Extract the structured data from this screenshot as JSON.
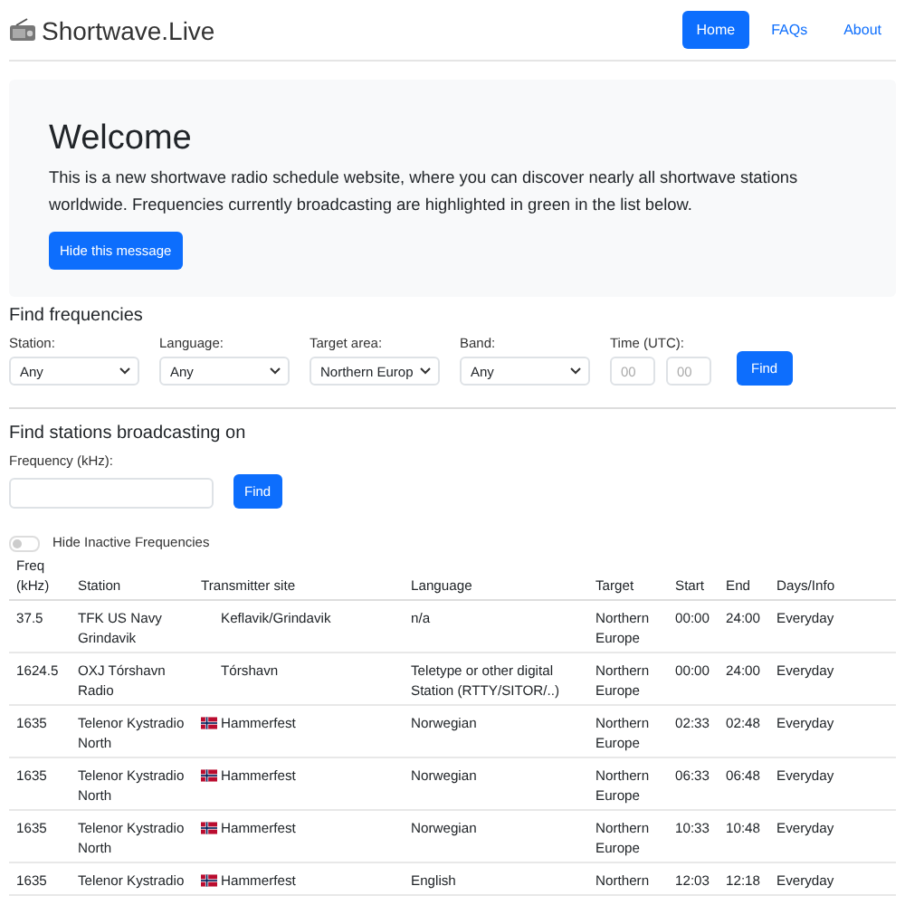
{
  "brand": "Shortwave.Live",
  "nav": [
    {
      "label": "Home",
      "selected": true
    },
    {
      "label": "FAQs",
      "selected": false
    },
    {
      "label": "About",
      "selected": false
    }
  ],
  "hero": {
    "title": "Welcome",
    "text": "This is a new shortwave radio schedule website, where you can discover nearly all shortwave stations worldwide. Frequencies currently broadcasting are highlighted in green in the list below.",
    "button": "Hide this message"
  },
  "find_frequencies": {
    "title": "Find frequencies",
    "fields": [
      {
        "kind": "select",
        "label": "Station:",
        "value": "Any"
      },
      {
        "kind": "select",
        "label": "Language:",
        "value": "Any"
      },
      {
        "kind": "select",
        "label": "Target area:",
        "value": "Northern Europ"
      },
      {
        "kind": "select",
        "label": "Band:",
        "value": "Any"
      },
      {
        "kind": "time",
        "label": "Time (UTC):",
        "placeholders": [
          "00",
          "00"
        ]
      }
    ],
    "button": "Find"
  },
  "find_stations": {
    "title": "Find stations broadcasting on",
    "label": "Frequency (kHz):",
    "button": "Find"
  },
  "hide_inactive": {
    "label": "Hide Inactive Frequencies",
    "on": false
  },
  "table": {
    "columns": [
      "Freq (kHz)",
      "Station",
      "Transmitter site",
      "Language",
      "Target",
      "Start",
      "End",
      "Days/Info"
    ],
    "rows": [
      {
        "freq": "37.5",
        "station": "TFK US Navy Grindavik",
        "flag": false,
        "site": "Keflavik/Grindavik",
        "language": "n/a",
        "target": "Northern Europe",
        "start": "00:00",
        "end": "24:00",
        "days": "Everyday"
      },
      {
        "freq": "1624.5",
        "station": "OXJ Tórshavn Radio",
        "flag": false,
        "site": "Tórshavn",
        "language": "Teletype or other digital Station (RTTY/SITOR/..)",
        "target": "Northern Europe",
        "start": "00:00",
        "end": "24:00",
        "days": "Everyday"
      },
      {
        "freq": "1635",
        "station": "Telenor Kystradio North",
        "flag": true,
        "site": "Hammerfest",
        "language": "Norwegian",
        "target": "Northern Europe",
        "start": "02:33",
        "end": "02:48",
        "days": "Everyday"
      },
      {
        "freq": "1635",
        "station": "Telenor Kystradio North",
        "flag": true,
        "site": "Hammerfest",
        "language": "Norwegian",
        "target": "Northern Europe",
        "start": "06:33",
        "end": "06:48",
        "days": "Everyday"
      },
      {
        "freq": "1635",
        "station": "Telenor Kystradio North",
        "flag": true,
        "site": "Hammerfest",
        "language": "Norwegian",
        "target": "Northern Europe",
        "start": "10:33",
        "end": "10:48",
        "days": "Everyday"
      },
      {
        "freq": "1635",
        "station": "Telenor Kystradio",
        "flag": true,
        "site": "Hammerfest",
        "language": "English",
        "target": "Northern",
        "start": "12:03",
        "end": "12:18",
        "days": "Everyday"
      }
    ]
  }
}
